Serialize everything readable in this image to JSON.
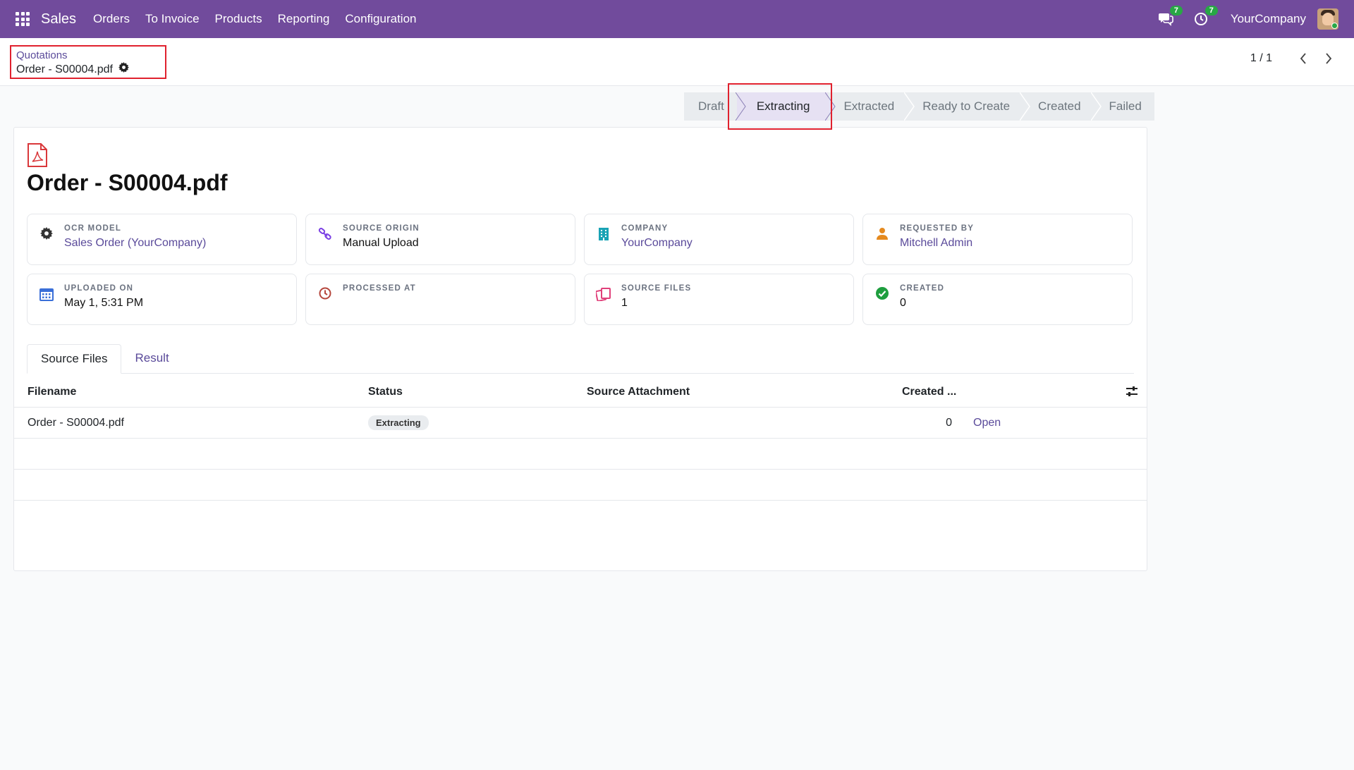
{
  "navbar": {
    "app": "Sales",
    "menu": [
      "Orders",
      "To Invoice",
      "Products",
      "Reporting",
      "Configuration"
    ],
    "messages_count": "7",
    "activities_count": "7",
    "company": "YourCompany"
  },
  "breadcrumb": {
    "parent": "Quotations",
    "current": "Order - S00004.pdf"
  },
  "pager": {
    "value": "1 / 1"
  },
  "statusbar": {
    "stages": [
      "Draft",
      "Extracting",
      "Extracted",
      "Ready to Create",
      "Created",
      "Failed"
    ],
    "active": "Extracting"
  },
  "record": {
    "title": "Order - S00004.pdf",
    "fields": [
      {
        "label": "OCR MODEL",
        "value": "Sales Order (YourCompany)",
        "icon": "gear-icon"
      },
      {
        "label": "SOURCE ORIGIN",
        "value": "Manual Upload",
        "icon": "link-icon"
      },
      {
        "label": "COMPANY",
        "value": "YourCompany",
        "icon": "building-icon"
      },
      {
        "label": "REQUESTED BY",
        "value": "Mitchell Admin",
        "icon": "user-icon"
      },
      {
        "label": "UPLOADED ON",
        "value": "May 1, 5:31 PM",
        "icon": "calendar-icon"
      },
      {
        "label": "PROCESSED AT",
        "value": "",
        "icon": "clock-icon"
      },
      {
        "label": "SOURCE FILES",
        "value": "1",
        "icon": "files-icon"
      },
      {
        "label": "CREATED",
        "value": "0",
        "icon": "check-circle-icon"
      }
    ]
  },
  "tabs": [
    "Source Files",
    "Result"
  ],
  "table": {
    "headers": {
      "filename": "Filename",
      "status": "Status",
      "attachment": "Source Attachment",
      "created": "Created ..."
    },
    "rows": [
      {
        "filename": "Order - S00004.pdf",
        "status": "Extracting",
        "attachment": "",
        "created": "0",
        "action": "Open"
      }
    ]
  },
  "colors": {
    "navbar": "#714b9c",
    "link": "#5a4a9a",
    "highlight": "#e0212e"
  }
}
